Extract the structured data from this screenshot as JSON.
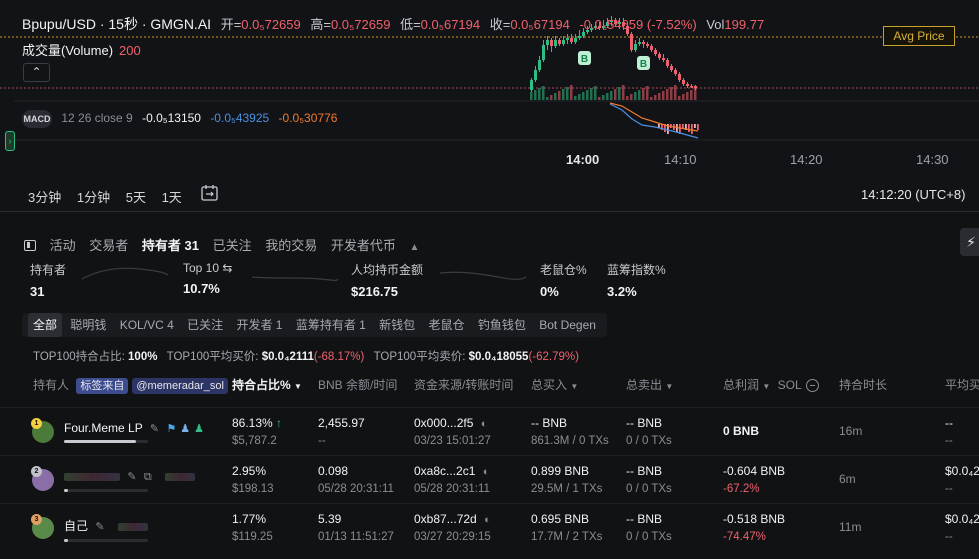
{
  "chart": {
    "pair": "Bpupu/USD · 15秒 · GMGN.AI",
    "open_label": "开=",
    "open_value": "0.0₅72659",
    "high_label": "高=",
    "high_value": "0.0₅72659",
    "low_label": "低=",
    "low_value": "0.0₅67194",
    "close_label": "收=",
    "close_value": "0.0₅67194",
    "change": "-0.0₆54659 (-7.52%)",
    "vol_label": "Vol",
    "vol_value": "199.77",
    "volume_label": "成交量(Volume)",
    "volume_value": "200",
    "collapse": "⌃",
    "avg_price": "Avg Price",
    "macd_logo": "MACD",
    "macd_params": "12 26 close 9",
    "macd_v1": "-0.0₅13150",
    "macd_v2": "-0.0₅43925",
    "macd_v3": "-0.0₅30776",
    "left_tab": "›",
    "time_labels": [
      "14:00",
      "14:10",
      "14:20",
      "14:30"
    ],
    "intervals": [
      "3分钟",
      "1分钟",
      "5天",
      "1天"
    ],
    "clock": "14:12:20 (UTC+8)",
    "marker_b": "B",
    "colors": {
      "up": "#2ebd85",
      "down": "#f0616d",
      "avg": "#c9a227"
    }
  },
  "panel": {
    "tabs": [
      "活动",
      "交易者",
      "持有者 31",
      "已关注",
      "我的交易",
      "开发者代币"
    ],
    "tab_caret": "▲",
    "flash": "⚡",
    "stats": [
      {
        "label": "持有者",
        "value": "31"
      },
      {
        "label": "Top 10 ⇆",
        "value": "10.7%"
      },
      {
        "label": "人均持币金额",
        "value": "$216.75"
      },
      {
        "label": "老鼠仓%",
        "value": "0%"
      },
      {
        "label": "蓝筹指数%",
        "value": "3.2%"
      }
    ],
    "filters": [
      "全部",
      "聪明钱",
      "KOL/VC 4",
      "已关注",
      "开发者 1",
      "蓝筹持有者 1",
      "新钱包",
      "老鼠仓",
      "钓鱼钱包",
      "Bot Degen"
    ],
    "top100": {
      "ratio_label": "TOP100持合占比:",
      "ratio_value": "100%",
      "avg_buy_label": "TOP100平均买价:",
      "avg_buy_value": "$0.0₄2111",
      "avg_buy_change": "(-68.17%)",
      "avg_sell_label": "TOP100平均卖价:",
      "avg_sell_value": "$0.0₄18055",
      "avg_sell_change": "(-62.79%)"
    },
    "headers": {
      "holder": "持有人",
      "tag_from": "标签来自",
      "tag_source": "@memeradar_sol",
      "hold_pct": "持合占比%",
      "bnb_balance": "BNB 余额/时间",
      "source": "资金来源/转账时间",
      "total_buy": "总买入",
      "total_sell": "总卖出",
      "total_profit": "总利润",
      "sol": "SOL",
      "hold_time": "持合时长",
      "avg_buy": "平均买"
    },
    "rows": [
      {
        "rank": "1",
        "name": "Four.Meme LP",
        "pct": "86.13%",
        "pct_arrow": "↑",
        "pct_usd": "$5,787.2",
        "pct_fill": 0.86,
        "bnb": "2,455.97",
        "bnb_time": "--",
        "src": "0x000...2f5",
        "src_time": "03/23 15:01:27",
        "buy": "-- BNB",
        "buy_sub": "861.3M / 0 TXs",
        "sell": "-- BNB",
        "sell_sub": "0 / 0 TXs",
        "profit": "0 BNB",
        "profit_pct": "",
        "hold": "16m",
        "avg1": "--",
        "avg2": "--"
      },
      {
        "rank": "2",
        "name": "",
        "pct": "2.95%",
        "pct_arrow": "",
        "pct_usd": "$198.13",
        "pct_fill": 0.03,
        "bnb": "0.098",
        "bnb_time": "05/28 20:31:11",
        "src": "0xa8c...2c1",
        "src_time": "05/28 20:31:11",
        "buy": "0.899 BNB",
        "buy_sub": "29.5M / 1 TXs",
        "sell": "-- BNB",
        "sell_sub": "0 / 0 TXs",
        "profit": "-0.604 BNB",
        "profit_pct": "-67.2%",
        "hold": "6m",
        "avg1": "$0.0₄2",
        "avg2": "--"
      },
      {
        "rank": "3",
        "name": "自己",
        "pct": "1.77%",
        "pct_arrow": "",
        "pct_usd": "$119.25",
        "pct_fill": 0.02,
        "bnb": "5.39",
        "bnb_time": "01/13 11:51:27",
        "src": "0xb87...72d",
        "src_time": "03/27 20:29:15",
        "buy": "0.695 BNB",
        "buy_sub": "17.7M / 2 TXs",
        "sell": "-- BNB",
        "sell_sub": "0 / 0 TXs",
        "profit": "-0.518 BNB",
        "profit_pct": "-74.47%",
        "hold": "11m",
        "avg1": "$0.0₄2",
        "avg2": "--"
      }
    ]
  }
}
